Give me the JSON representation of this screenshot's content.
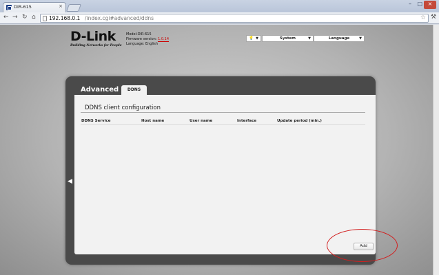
{
  "browser": {
    "tab_title": "DIR-615",
    "tab_close": "×",
    "url_host": "192.168.0.1",
    "url_path": "/index.cgi#advanced/ddns",
    "back_glyph": "←",
    "forward_glyph": "→",
    "reload_glyph": "↻",
    "home_glyph": "⌂",
    "star_glyph": "☆",
    "wrench_glyph": "⚒",
    "minimize_glyph": "–",
    "maximize_glyph": "□",
    "close_glyph": "×"
  },
  "header": {
    "brand": "D-Link",
    "tagline": "Building Networks for People",
    "model": "Model:DIR-615",
    "firmware_label": "Firmware version:",
    "firmware_version": "1.0.14",
    "language_info": "Language: English",
    "bulb_glyph": "💡",
    "menu_system": "System",
    "menu_language": "Language",
    "caret": "▼"
  },
  "panel": {
    "title": "Advanced »",
    "tab": "DDNS",
    "back_glyph": "◀",
    "section_title": "DDNS client configuration",
    "columns": [
      "DDNS Service",
      "Host name",
      "User name",
      "Interface",
      "Update period (min.)"
    ],
    "rows": [],
    "add_button": "Add"
  },
  "colors": {
    "firmware_version": "#cc0000",
    "annotation": "#d21f1f",
    "panel_frame": "#4a4a4a"
  }
}
